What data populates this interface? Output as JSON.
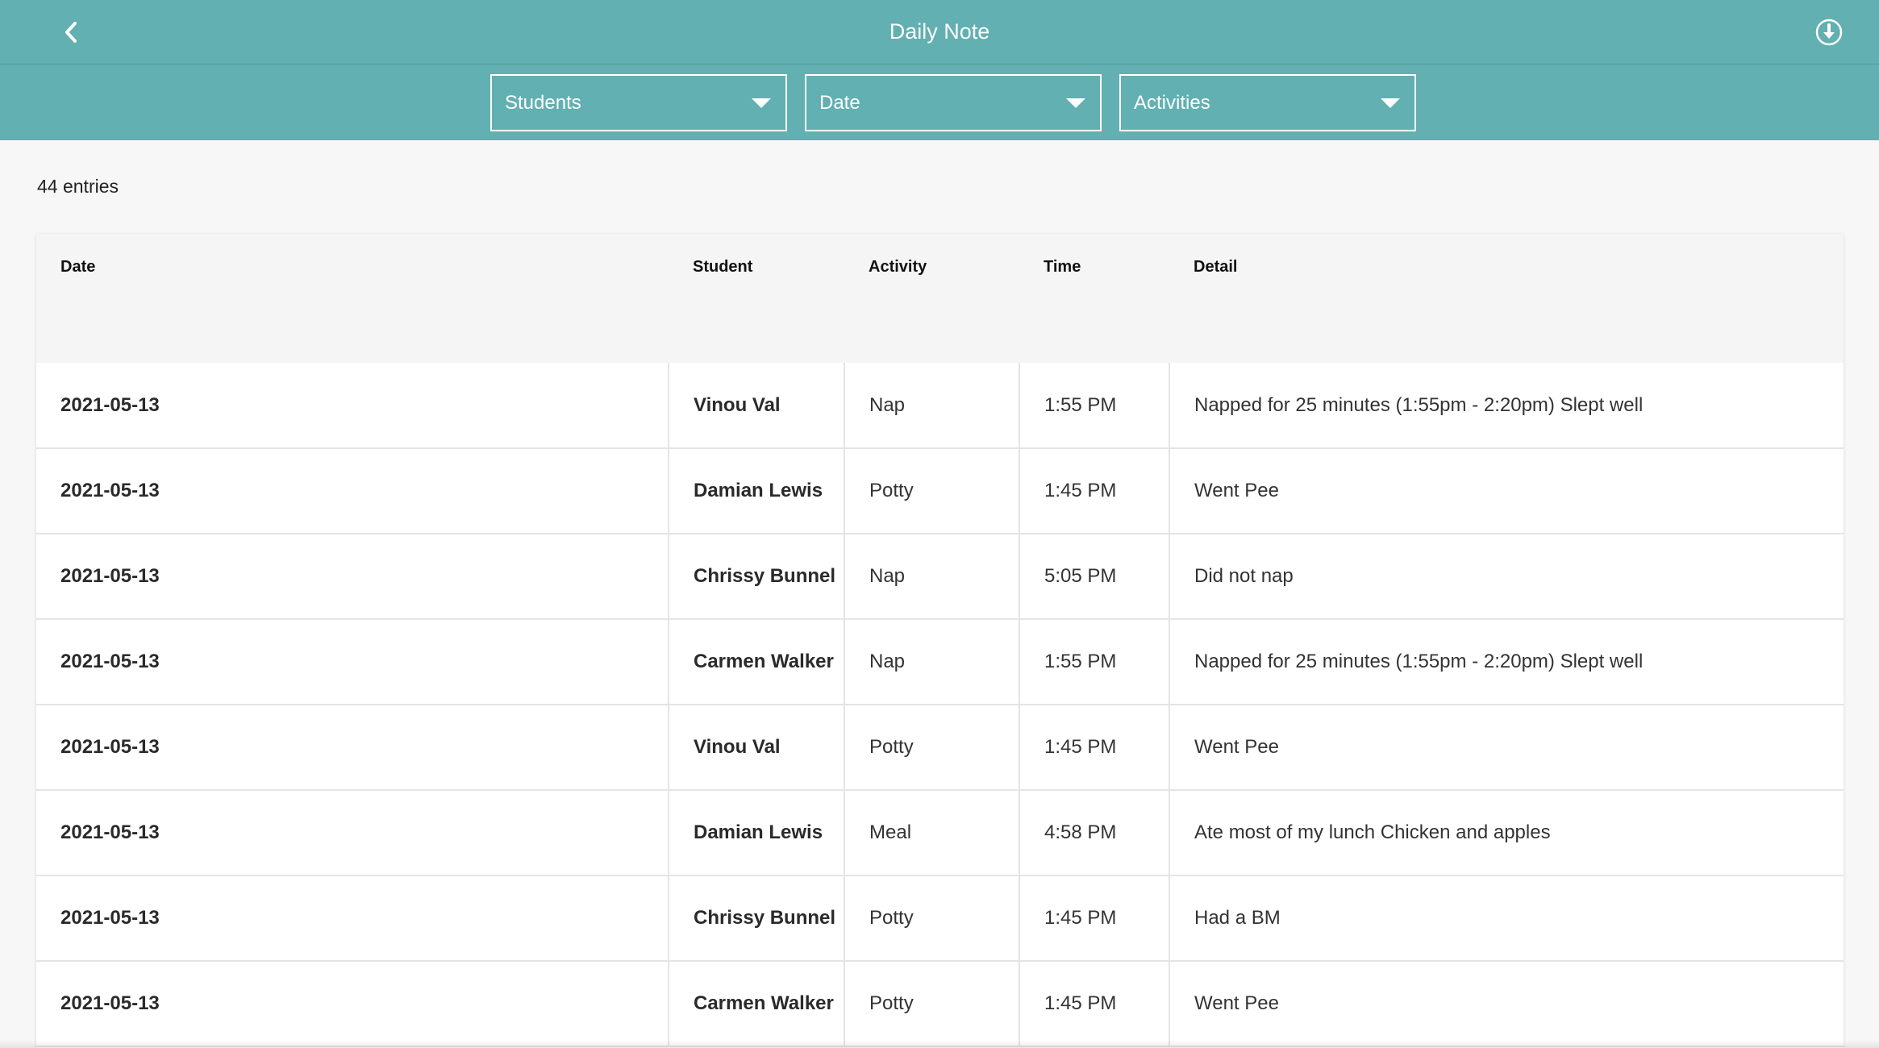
{
  "header": {
    "title": "Daily Note",
    "back_icon": "chevron-left-icon",
    "download_icon": "download-circle-icon"
  },
  "filters": [
    {
      "label": "Students"
    },
    {
      "label": "Date"
    },
    {
      "label": "Activities"
    }
  ],
  "entries_count": "44 entries",
  "table": {
    "columns": [
      "Date",
      "Student",
      "Activity",
      "Time",
      "Detail"
    ],
    "rows": [
      [
        "2021-05-13",
        "Vinou Val",
        "Nap",
        "1:55 PM",
        "Napped for 25 minutes (1:55pm - 2:20pm) Slept well"
      ],
      [
        "2021-05-13",
        "Damian Lewis",
        "Potty",
        "1:45 PM",
        "Went Pee"
      ],
      [
        "2021-05-13",
        "Chrissy Bunnel",
        "Nap",
        "5:05 PM",
        "Did not nap"
      ],
      [
        "2021-05-13",
        "Carmen Walker",
        "Nap",
        "1:55 PM",
        "Napped for 25 minutes (1:55pm - 2:20pm) Slept well"
      ],
      [
        "2021-05-13",
        "Vinou Val",
        "Potty",
        "1:45 PM",
        "Went Pee"
      ],
      [
        "2021-05-13",
        "Damian Lewis",
        "Meal",
        "4:58 PM",
        "Ate most of my lunch Chicken and apples"
      ],
      [
        "2021-05-13",
        "Chrissy Bunnel",
        "Potty",
        "1:45 PM",
        "Had a BM"
      ],
      [
        "2021-05-13",
        "Carmen Walker",
        "Potty",
        "1:45 PM",
        "Went Pee"
      ]
    ]
  },
  "colors": {
    "header_bg": "#62b0b1",
    "page_bg": "#f7f7f7",
    "table_header_bg": "#f5f5f5",
    "row_border": "#e4e4e4"
  }
}
